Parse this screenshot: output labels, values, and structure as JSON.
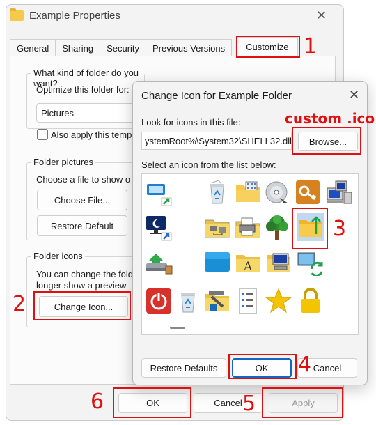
{
  "properties_window": {
    "title": "Example Properties",
    "tabs": [
      {
        "label": "General"
      },
      {
        "label": "Sharing"
      },
      {
        "label": "Security"
      },
      {
        "label": "Previous Versions"
      },
      {
        "label": "Customize",
        "selected": true
      }
    ],
    "folder_type_group": {
      "label": "What kind of folder do you want?",
      "optimize_label": "Optimize this folder for:",
      "optimize_value": "Pictures",
      "apply_subfolders_label": "Also apply this temp",
      "apply_subfolders_checked": false
    },
    "folder_pictures_group": {
      "label": "Folder pictures",
      "description": "Choose a file to show o",
      "choose_file_label": "Choose File...",
      "restore_default_label": "Restore Default"
    },
    "folder_icons_group": {
      "label": "Folder icons",
      "description_line1": "You can change the fold",
      "description_line2": "longer show a preview",
      "change_icon_label": "Change Icon..."
    },
    "ok_label": "OK",
    "cancel_label": "Cancel",
    "apply_label": "Apply"
  },
  "change_icon_dialog": {
    "title": "Change Icon for Example Folder",
    "look_for_label": "Look for icons in this file:",
    "file_path": "ystemRoot%\\System32\\SHELL32.dll",
    "browse_label": "Browse...",
    "select_label": "Select an icon from the list below:",
    "icons": [
      {
        "name": "window-shortcut-icon"
      },
      {
        "name": "recycle-bin-full-icon"
      },
      {
        "name": "folder-grid-icon"
      },
      {
        "name": "cd-disc-icon"
      },
      {
        "name": "key-icon"
      },
      {
        "name": "computer-network-icon"
      },
      {
        "name": "monitor-sleep-shortcut-icon"
      },
      {
        "name": "folder-network-icon"
      },
      {
        "name": "folder-printer-icon"
      },
      {
        "name": "tree-icon"
      },
      {
        "name": "folder-upload-icon",
        "selected": true
      },
      {
        "name": "drive-eject-icon"
      },
      {
        "name": "panel-icon"
      },
      {
        "name": "folder-font-icon"
      },
      {
        "name": "folder-computer-icon"
      },
      {
        "name": "monitor-sync-icon"
      },
      {
        "name": "power-icon"
      },
      {
        "name": "recycle-bin-empty-icon"
      },
      {
        "name": "folder-tools-icon"
      },
      {
        "name": "server-list-icon"
      },
      {
        "name": "star-icon"
      },
      {
        "name": "padlock-icon"
      }
    ],
    "restore_defaults_label": "Restore Defaults",
    "ok_label": "OK",
    "cancel_label": "Cancel"
  },
  "annotations": {
    "n1": "1",
    "n2": "2",
    "n3": "3",
    "n4": "4",
    "n5": "5",
    "n6": "6",
    "custom_ico": "custom .ico",
    "color": "#e01010"
  }
}
